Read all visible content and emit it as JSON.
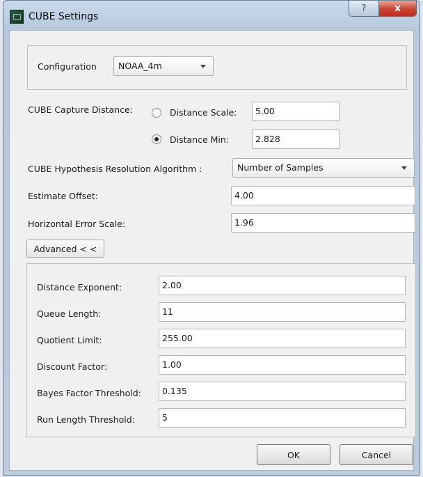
{
  "window": {
    "title": "CUBE Settings",
    "help_glyph": "?",
    "close_glyph": "x"
  },
  "config": {
    "label": "Configuration",
    "value": "NOAA_4m"
  },
  "capture": {
    "label": "CUBE Capture Distance:",
    "scale_label": "Distance Scale:",
    "scale_value": "5.00",
    "min_label": "Distance Min:",
    "min_value": "2.828",
    "selected": "Distance Min"
  },
  "hypothesis": {
    "label": "CUBE Hypothesis Resolution Algorithm :",
    "value": "Number of  Samples"
  },
  "estimate_offset": {
    "label": "Estimate Offset:",
    "value": "4.00"
  },
  "horizontal_error": {
    "label": "Horizontal Error Scale:",
    "value": "1.96"
  },
  "advanced_button": "Advanced < <",
  "advanced": [
    {
      "label": "Distance Exponent:",
      "value": "2.00"
    },
    {
      "label": "Queue Length:",
      "value": "11"
    },
    {
      "label": "Quotient Limit:",
      "value": "255.00"
    },
    {
      "label": "Discount Factor:",
      "value": "1.00"
    },
    {
      "label": "Bayes Factor Threshold:",
      "value": "0.135"
    },
    {
      "label": "Run Length Threshold:",
      "value": "5"
    }
  ],
  "buttons": {
    "ok": "OK",
    "cancel": "Cancel"
  }
}
